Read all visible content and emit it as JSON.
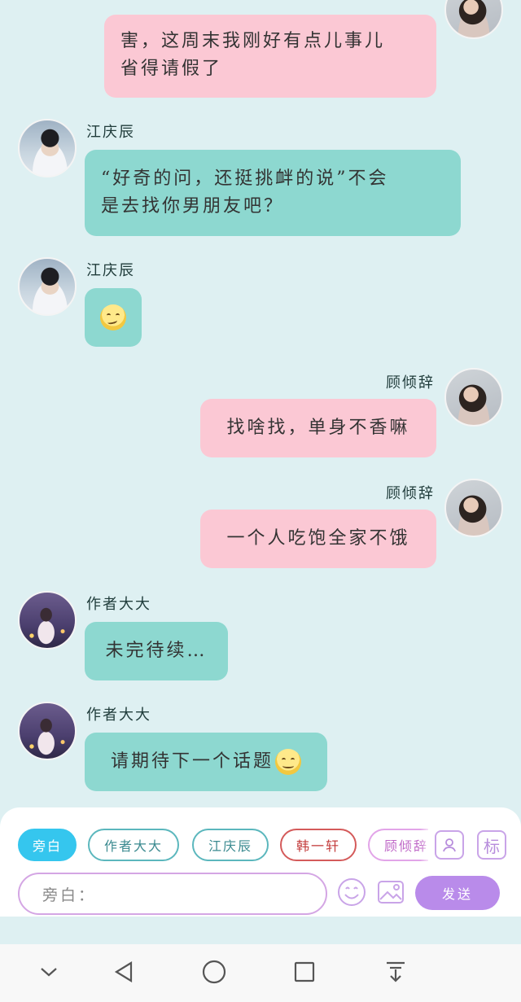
{
  "messages": [
    {
      "sender": "",
      "text": "害，这周末我刚好有点儿事儿省得请假了",
      "line1": "害，这周末我刚好有点儿事儿",
      "line2": "省得请假了",
      "side": "right"
    },
    {
      "sender": "江庆辰",
      "line1": "“好奇的问，还挺挑衅的说”不会",
      "line2": "是去找你男朋友吧？",
      "side": "left"
    },
    {
      "sender": "江庆辰",
      "emoji": "smirk-emoji",
      "side": "left"
    },
    {
      "sender": "顾倾辞",
      "text": "找啥找，单身不香嘛",
      "side": "right"
    },
    {
      "sender": "顾倾辞",
      "text": "一个人吃饱全家不饿",
      "side": "right"
    },
    {
      "sender": "作者大大",
      "text": "未完待续…",
      "side": "left"
    },
    {
      "sender": "作者大大",
      "text": "请期待下一个话题",
      "emoji": "smile-emoji",
      "side": "left"
    }
  ],
  "roles": [
    {
      "label": "旁白",
      "style": "active"
    },
    {
      "label": "作者大大",
      "style": "teal"
    },
    {
      "label": "江庆辰",
      "style": "teal"
    },
    {
      "label": "韩一轩",
      "style": "red"
    },
    {
      "label": "顾倾辞",
      "style": "pink"
    }
  ],
  "toolbar": {
    "role_icon": "person-card-icon",
    "tag_label": "标",
    "input_placeholder": "旁白：",
    "emoji_icon": "emoji-icon",
    "image_icon": "image-icon",
    "send_label": "发送"
  },
  "navbar": [
    "chevron-down-icon",
    "back-triangle-icon",
    "home-circle-icon",
    "recents-square-icon",
    "download-icon"
  ],
  "colors": {
    "teal_bubble": "#8dd8d0",
    "pink_bubble": "#fbc8d4",
    "background": "#def0f2",
    "send": "#b98bea",
    "active_chip": "#35c6ee"
  }
}
